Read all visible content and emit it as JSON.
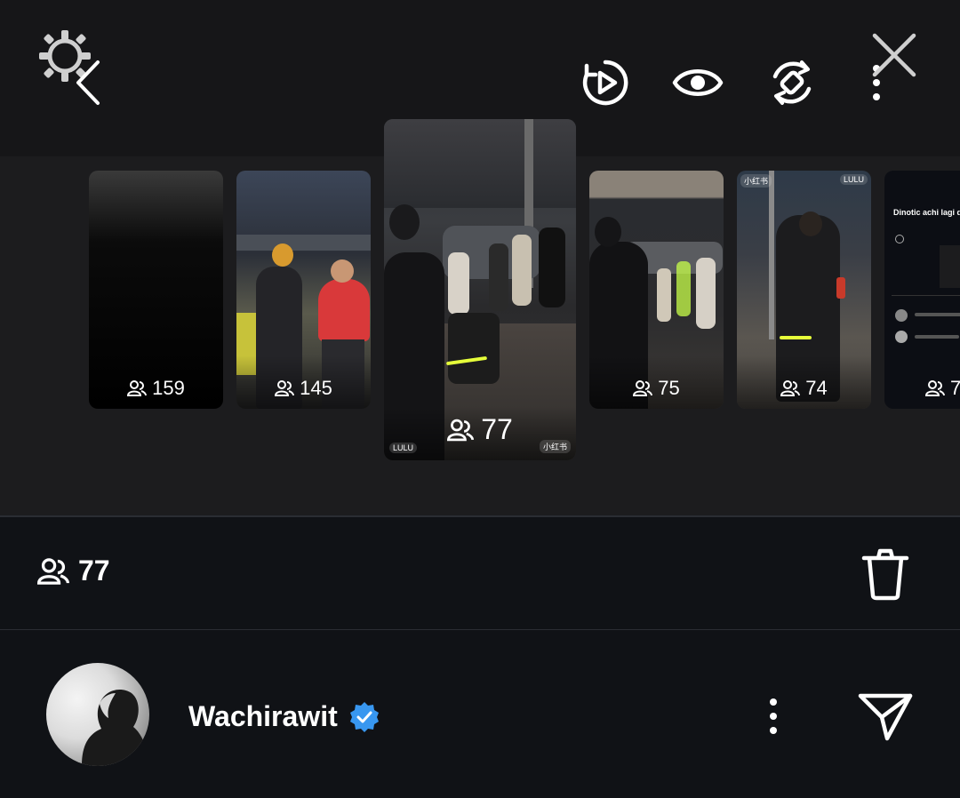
{
  "colors": {
    "top_background": "#1c1c1e",
    "panel_background": "#101216",
    "verified_blue": "#3897f0",
    "highlight_yellow": "#e6ff3a"
  },
  "header": {
    "icons": [
      "settings-icon",
      "back-icon",
      "replay-icon",
      "eye-icon",
      "boomerang-icon",
      "more-vertical-icon",
      "close-icon"
    ]
  },
  "stories": [
    {
      "viewers": "159"
    },
    {
      "viewers": "145"
    },
    {
      "viewers": "77",
      "user_tag": "LULU",
      "badge": "小红书",
      "selected": true
    },
    {
      "viewers": "75"
    },
    {
      "viewers": "74",
      "badge": "小红书",
      "user_tag": "LULU"
    },
    {
      "viewers": "7",
      "caption": "Dinotic achi lagi de"
    }
  ],
  "selected_story": {
    "viewers": "77"
  },
  "user": {
    "name": "Wachirawit",
    "verified": true
  }
}
